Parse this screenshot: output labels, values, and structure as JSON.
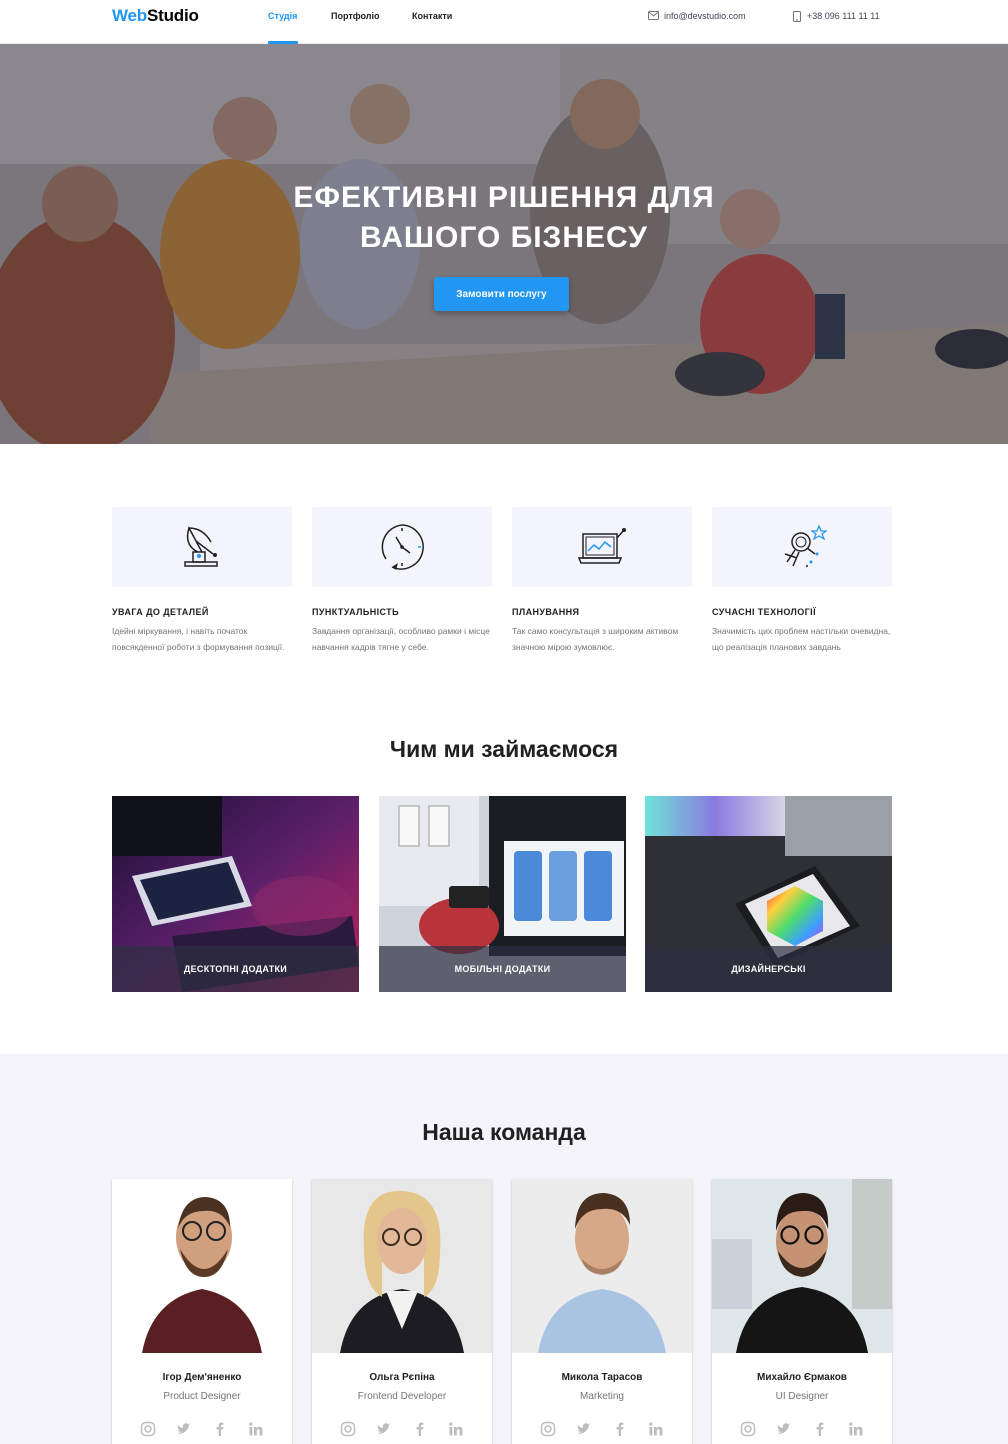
{
  "header": {
    "logo_part1": "Web",
    "logo_part2": "Studio",
    "nav": [
      "Студія",
      "Портфоліо",
      "Контакти"
    ],
    "email": "info@devstudio.com",
    "phone": "+38 096 111 11 11"
  },
  "hero": {
    "title": "Ефективні рішення для вашого бізнесу",
    "button": "Замовити послугу"
  },
  "features": [
    {
      "icon": "satellite-dish-icon",
      "title": "Увага до деталей",
      "text": "Ідейні міркування, і навіть початок повсякденної роботи з формування позиції."
    },
    {
      "icon": "clock-icon",
      "title": "Пунктуальність",
      "text": "Завдання організації, особливо рамки і місце навчання кадрів тягне у себе."
    },
    {
      "icon": "laptop-chart-icon",
      "title": "Планування",
      "text": "Так само консультація з широким активом значною мірою зумовлює."
    },
    {
      "icon": "astronaut-icon",
      "title": "Сучасні технології",
      "text": "Значимість цих проблем настільки очевидна, що реалізація планових завдань"
    }
  ],
  "services": {
    "title": "Чим ми займаємося",
    "items": [
      "Десктопні додатки",
      "Мобільні додатки",
      "Дизайнерські"
    ]
  },
  "team": {
    "title": "Наша команда",
    "members": [
      {
        "name": "Ігор Дем'яненко",
        "role": "Product Designer"
      },
      {
        "name": "Ольга Рєпіна",
        "role": "Frontend Developer"
      },
      {
        "name": "Микола Тарасов",
        "role": "Marketing"
      },
      {
        "name": "Михайло Єрмаков",
        "role": "UI Designer"
      }
    ],
    "social_icons": [
      "instagram-icon",
      "twitter-icon",
      "facebook-icon",
      "linkedin-icon"
    ]
  },
  "colors": {
    "accent": "#2196f3",
    "dark": "#212121",
    "muted": "#757575",
    "light_bg": "#f5f4fa"
  }
}
